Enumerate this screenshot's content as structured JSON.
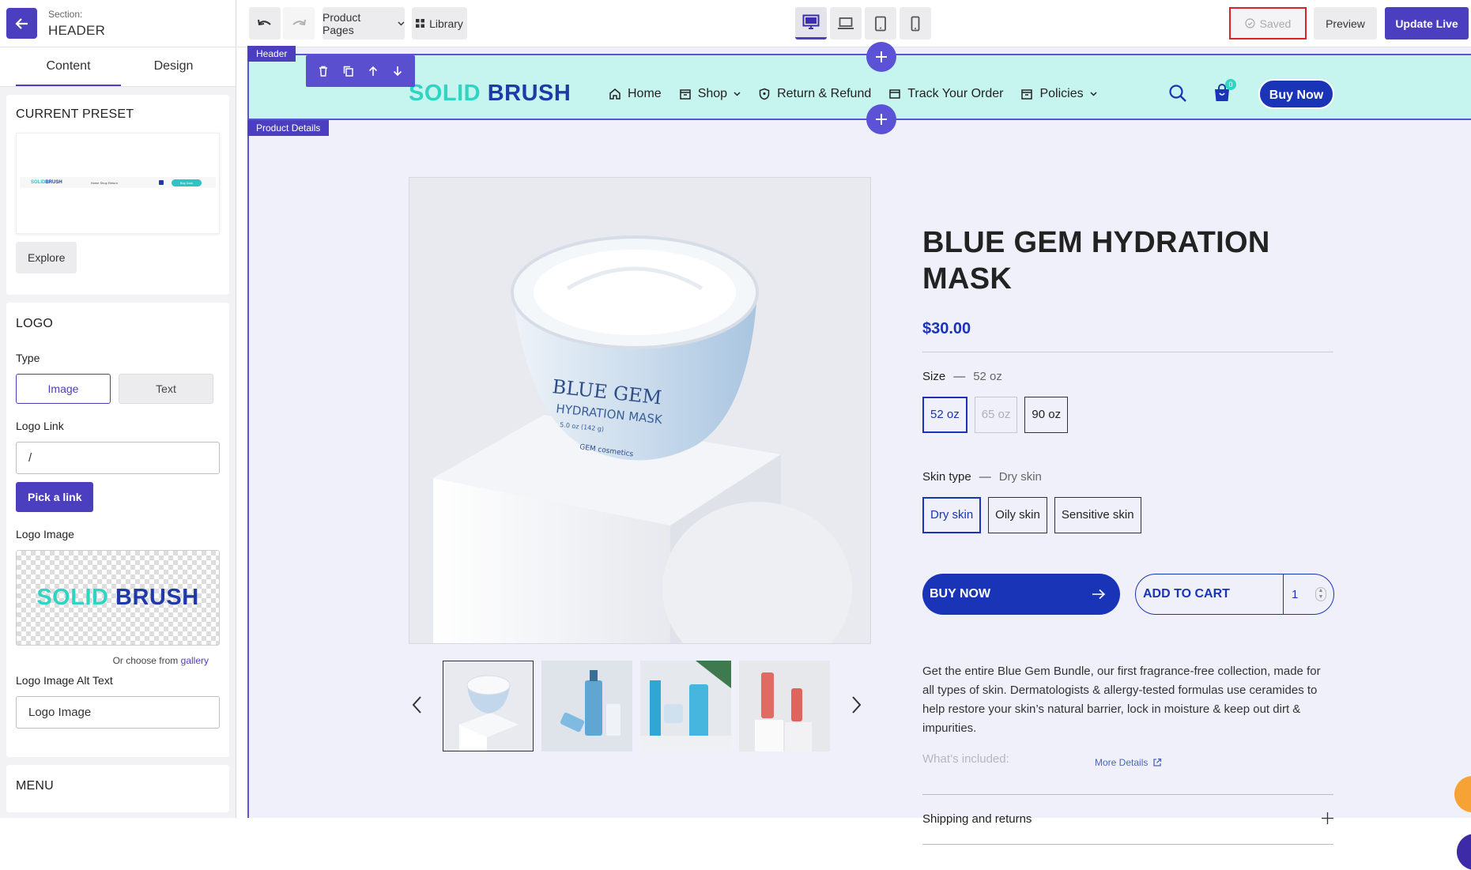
{
  "left_panel": {
    "section_label": "Section:",
    "section_name": "HEADER",
    "tabs": [
      "Content",
      "Design"
    ],
    "current_preset": {
      "title": "CURRENT PRESET",
      "explore_label": "Explore",
      "preview_logo_a": "SOLID",
      "preview_logo_b": "BRUSH",
      "preview_nav": "Home   Shop   Return",
      "preview_btn": "Buy Now"
    },
    "logo": {
      "title": "LOGO",
      "type_label": "Type",
      "type_options": [
        "Image",
        "Text"
      ],
      "logo_link_label": "Logo Link",
      "logo_link_value": "/",
      "pick_link_label": "Pick a link",
      "logo_image_label": "Logo Image",
      "logo_text_a": "SOLID",
      "logo_text_b": "BRUSH",
      "gallery_prefix": "Or choose from",
      "gallery_link": "gallery",
      "alt_text_label": "Logo Image Alt Text",
      "alt_text_value": "Logo Image"
    },
    "menu_title": "MENU"
  },
  "topbar": {
    "product_pages_label": "Product Pages",
    "library_label": "Library",
    "saved_label": "Saved",
    "preview_label": "Preview",
    "update_label": "Update Live"
  },
  "canvas": {
    "header_tag": "Header",
    "product_details_tag": "Product Details",
    "site": {
      "logo_a": "SOLID",
      "logo_b": "BRUSH",
      "nav": [
        "Home",
        "Shop",
        "Return & Refund",
        "Track Your Order",
        "Policies"
      ],
      "cart_count": "0",
      "buy_now_label": "Buy Now"
    },
    "product": {
      "title": "BLUE GEM HYDRATION MASK",
      "price": "$30.00",
      "jar_text_1": "BLUE GEM",
      "jar_text_2": "HYDRATION MASK",
      "jar_text_3": "5.0 oz (142 g)",
      "jar_brand": "GEM cosmetics",
      "size_label": "Size",
      "size_selected": "52 oz",
      "sizes": [
        "52 oz",
        "65 oz",
        "90 oz"
      ],
      "skin_label": "Skin type",
      "skin_selected": "Dry skin",
      "skins": [
        "Dry skin",
        "Oily skin",
        "Sensitive skin"
      ],
      "buy_now": "BUY NOW",
      "add_to_cart": "ADD TO CART",
      "quantity": "1",
      "description": "Get the entire Blue Gem Bundle, our first fragrance-free collection, made for all types of skin. Dermatologists & allergy-tested formulas use ceramides to help restore your skin’s natural barrier, lock in moisture & keep out dirt & impurities.",
      "whats_included": "What’s included:",
      "more_details": "More Details",
      "shipping": "Shipping and returns"
    }
  },
  "colors": {
    "accent": "#4b3fbf",
    "brand_blue": "#1a34b8",
    "brand_teal": "#2fd4c3",
    "header_bg": "#c6f5ef",
    "canvas_bg": "#f0f0fb",
    "saved_outline": "#d6242a"
  },
  "icons": [
    "back-arrow-icon",
    "undo-icon",
    "redo-icon",
    "chevron-down-icon",
    "grid-icon",
    "desktop-icon",
    "laptop-icon",
    "tablet-icon",
    "mobile-icon",
    "check-circle-icon",
    "trash-icon",
    "copy-icon",
    "arrow-up-icon",
    "arrow-down-icon",
    "plus-icon",
    "home-icon",
    "shop-icon",
    "shield-icon",
    "truck-icon",
    "policies-icon",
    "search-icon",
    "cart-icon",
    "arrow-right-icon",
    "external-link-icon",
    "chevron-left-icon",
    "chevron-right-icon"
  ]
}
